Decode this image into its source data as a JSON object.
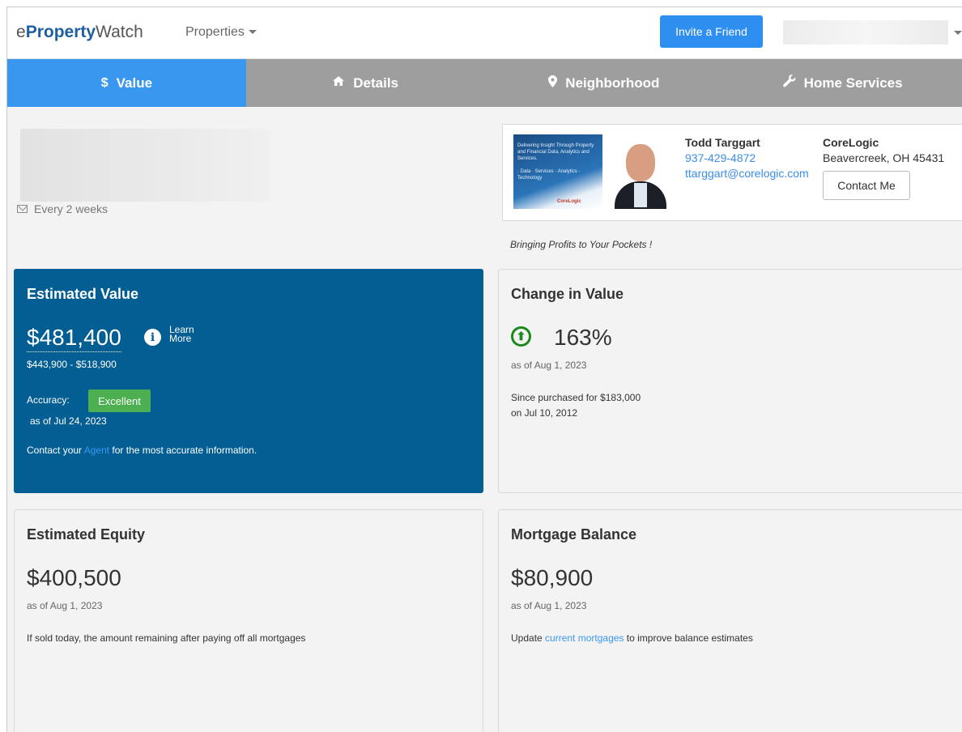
{
  "header": {
    "logo_prefix": "e",
    "logo_bold": "Property",
    "logo_suffix": "Watch",
    "properties_label": "Properties",
    "invite_label": "Invite a Friend"
  },
  "tabs": [
    {
      "label": "Value",
      "icon": "$"
    },
    {
      "label": "Details",
      "icon": "🏠"
    },
    {
      "label": "Neighborhood",
      "icon": "📍"
    },
    {
      "label": "Home Services",
      "icon": "🔧"
    }
  ],
  "subheader": {
    "frequency": "Every 2 weeks"
  },
  "agent": {
    "name": "Todd Targgart",
    "phone": "937-429-4872",
    "email": "ttarggart@corelogic.com",
    "company": "CoreLogic",
    "location": "Beavercreek, OH 45431",
    "contact_label": "Contact Me",
    "slogan": "Bringing Profits to Your Pockets !",
    "ad_text": "Delivering Insight Through Property and Financial Data, Analytics and Services.",
    "ad_items": "· Data · Services · Analytics · Technology",
    "ad_logo": "CoreLogic"
  },
  "estimated_value": {
    "title": "Estimated Value",
    "value": "$481,400",
    "info_icon": "i",
    "learn_more": "Learn More",
    "range": "$443,900 - $518,900",
    "accuracy_label": "Accuracy:",
    "accuracy_value": "Excellent",
    "as_of": "as of Jul 24, 2023",
    "contact_prefix": "Contact your",
    "contact_link": "Agent",
    "contact_suffix": "for the most accurate information."
  },
  "change_in_value": {
    "title": "Change in Value",
    "icon": "⬆",
    "value": "163%",
    "as_of": "as of Aug 1, 2023",
    "since_line": "Since purchased for $183,000",
    "date_line": "on Jul 10, 2012"
  },
  "estimated_equity": {
    "title": "Estimated Equity",
    "value": "$400,500",
    "as_of": "as of Aug 1, 2023",
    "description": "If sold today, the amount remaining after paying off all mortgages"
  },
  "mortgage_balance": {
    "title": "Mortgage Balance",
    "value": "$80,900",
    "as_of": "as of Aug 1, 2023",
    "update_prefix": "Update",
    "update_link": "current mortgages",
    "update_suffix": "to improve balance estimates"
  },
  "colors": {
    "accent": "#3a97f0",
    "card_blue": "#035e93",
    "badge_green": "#4caf50",
    "tab_gray": "#9e9e9e"
  }
}
